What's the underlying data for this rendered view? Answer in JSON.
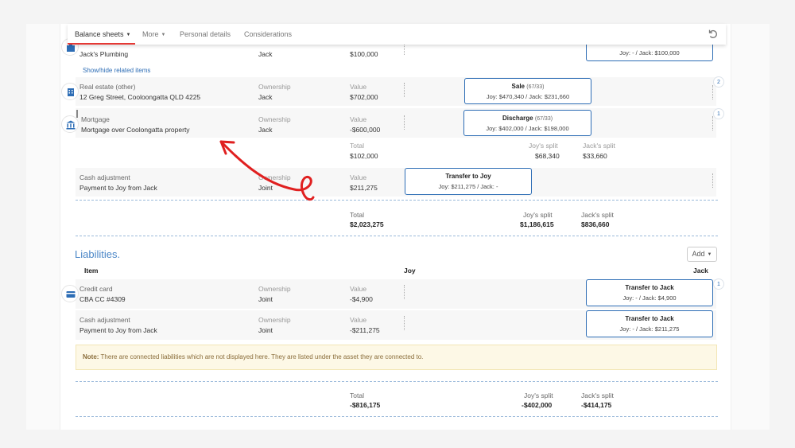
{
  "nav": {
    "tabs": [
      "Balance sheets",
      "More",
      "Personal details",
      "Considerations"
    ]
  },
  "assets": {
    "plumbing": {
      "name": "Jack's Plumbing",
      "owner": "Jack",
      "value": "$100,000",
      "split_sub": "Joy: - / Jack: $100,000"
    },
    "show_hide": "Show/hide related items",
    "real_estate": {
      "type": "Real estate (other)",
      "name": "12 Greg Street, Cooloongatta QLD 4225",
      "owner_label": "Ownership",
      "owner": "Jack",
      "value_label": "Value",
      "value": "$702,000",
      "split_title": "Sale",
      "split_ratio": "(67/33)",
      "split_sub": "Joy: $470,340 / Jack: $231,660",
      "badge": "2"
    },
    "mortgage": {
      "type": "Mortgage",
      "name": "Mortgage over Coolongatta property",
      "owner_label": "Ownership",
      "owner": "Jack",
      "value_label": "Value",
      "value": "-$600,000",
      "split_title": "Discharge",
      "split_ratio": "(67/33)",
      "split_sub": "Joy: $402,000 / Jack: $198,000",
      "badge": "1"
    },
    "subtotal": {
      "total_label": "Total",
      "total": "$102,000",
      "joy_label": "Joy's split",
      "joy": "$68,340",
      "jack_label": "Jack's split",
      "jack": "$33,660"
    },
    "cash": {
      "type": "Cash adjustment",
      "name": "Payment to Joy from Jack",
      "owner_label": "Ownership",
      "owner": "Joint",
      "value_label": "Value",
      "value": "$211,275",
      "split_title": "Transfer to Joy",
      "split_sub": "Joy: $211,275 / Jack: -"
    },
    "total": {
      "total_label": "Total",
      "total": "$2,023,275",
      "joy_label": "Joy's split",
      "joy": "$1,186,615",
      "jack_label": "Jack's split",
      "jack": "$836,660"
    }
  },
  "liabilities": {
    "title": "Liabilities.",
    "add_label": "Add",
    "headers": {
      "item": "Item",
      "joy": "Joy",
      "jack": "Jack"
    },
    "credit": {
      "type": "Credit card",
      "name": "CBA CC #4309",
      "owner_label": "Ownership",
      "owner": "Joint",
      "value_label": "Value",
      "value": "-$4,900",
      "split_title": "Transfer to Jack",
      "split_sub": "Joy: - / Jack: $4,900",
      "badge": "1"
    },
    "cash": {
      "type": "Cash adjustment",
      "name": "Payment to Joy from Jack",
      "owner_label": "Ownership",
      "owner": "Joint",
      "value_label": "Value",
      "value": "-$211,275",
      "split_title": "Transfer to Jack",
      "split_sub": "Joy: - / Jack: $211,275"
    },
    "note_label": "Note:",
    "note_text": "There are connected liabilities which are not displayed here. They are listed under the asset they are connected to.",
    "total": {
      "total_label": "Total",
      "total": "-$816,175",
      "joy_label": "Joy's split",
      "joy": "-$402,000",
      "jack_label": "Jack's split",
      "jack": "-$414,175"
    }
  },
  "colors": {
    "accent": "#2d6db5",
    "annotation": "#e02020",
    "active_tab": "#e53935"
  }
}
